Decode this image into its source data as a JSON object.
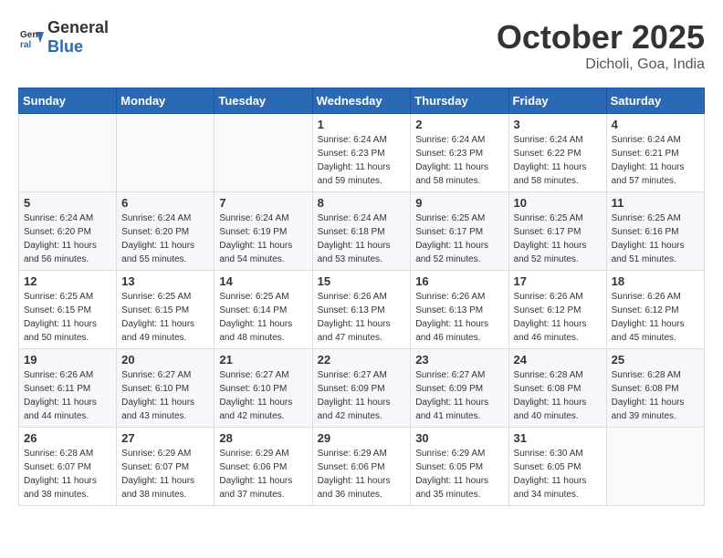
{
  "header": {
    "logo_general": "General",
    "logo_blue": "Blue",
    "month_title": "October 2025",
    "location": "Dicholi, Goa, India"
  },
  "weekdays": [
    "Sunday",
    "Monday",
    "Tuesday",
    "Wednesday",
    "Thursday",
    "Friday",
    "Saturday"
  ],
  "weeks": [
    [
      {
        "day": "",
        "info": ""
      },
      {
        "day": "",
        "info": ""
      },
      {
        "day": "",
        "info": ""
      },
      {
        "day": "1",
        "info": "Sunrise: 6:24 AM\nSunset: 6:23 PM\nDaylight: 11 hours\nand 59 minutes."
      },
      {
        "day": "2",
        "info": "Sunrise: 6:24 AM\nSunset: 6:23 PM\nDaylight: 11 hours\nand 58 minutes."
      },
      {
        "day": "3",
        "info": "Sunrise: 6:24 AM\nSunset: 6:22 PM\nDaylight: 11 hours\nand 58 minutes."
      },
      {
        "day": "4",
        "info": "Sunrise: 6:24 AM\nSunset: 6:21 PM\nDaylight: 11 hours\nand 57 minutes."
      }
    ],
    [
      {
        "day": "5",
        "info": "Sunrise: 6:24 AM\nSunset: 6:20 PM\nDaylight: 11 hours\nand 56 minutes."
      },
      {
        "day": "6",
        "info": "Sunrise: 6:24 AM\nSunset: 6:20 PM\nDaylight: 11 hours\nand 55 minutes."
      },
      {
        "day": "7",
        "info": "Sunrise: 6:24 AM\nSunset: 6:19 PM\nDaylight: 11 hours\nand 54 minutes."
      },
      {
        "day": "8",
        "info": "Sunrise: 6:24 AM\nSunset: 6:18 PM\nDaylight: 11 hours\nand 53 minutes."
      },
      {
        "day": "9",
        "info": "Sunrise: 6:25 AM\nSunset: 6:17 PM\nDaylight: 11 hours\nand 52 minutes."
      },
      {
        "day": "10",
        "info": "Sunrise: 6:25 AM\nSunset: 6:17 PM\nDaylight: 11 hours\nand 52 minutes."
      },
      {
        "day": "11",
        "info": "Sunrise: 6:25 AM\nSunset: 6:16 PM\nDaylight: 11 hours\nand 51 minutes."
      }
    ],
    [
      {
        "day": "12",
        "info": "Sunrise: 6:25 AM\nSunset: 6:15 PM\nDaylight: 11 hours\nand 50 minutes."
      },
      {
        "day": "13",
        "info": "Sunrise: 6:25 AM\nSunset: 6:15 PM\nDaylight: 11 hours\nand 49 minutes."
      },
      {
        "day": "14",
        "info": "Sunrise: 6:25 AM\nSunset: 6:14 PM\nDaylight: 11 hours\nand 48 minutes."
      },
      {
        "day": "15",
        "info": "Sunrise: 6:26 AM\nSunset: 6:13 PM\nDaylight: 11 hours\nand 47 minutes."
      },
      {
        "day": "16",
        "info": "Sunrise: 6:26 AM\nSunset: 6:13 PM\nDaylight: 11 hours\nand 46 minutes."
      },
      {
        "day": "17",
        "info": "Sunrise: 6:26 AM\nSunset: 6:12 PM\nDaylight: 11 hours\nand 46 minutes."
      },
      {
        "day": "18",
        "info": "Sunrise: 6:26 AM\nSunset: 6:12 PM\nDaylight: 11 hours\nand 45 minutes."
      }
    ],
    [
      {
        "day": "19",
        "info": "Sunrise: 6:26 AM\nSunset: 6:11 PM\nDaylight: 11 hours\nand 44 minutes."
      },
      {
        "day": "20",
        "info": "Sunrise: 6:27 AM\nSunset: 6:10 PM\nDaylight: 11 hours\nand 43 minutes."
      },
      {
        "day": "21",
        "info": "Sunrise: 6:27 AM\nSunset: 6:10 PM\nDaylight: 11 hours\nand 42 minutes."
      },
      {
        "day": "22",
        "info": "Sunrise: 6:27 AM\nSunset: 6:09 PM\nDaylight: 11 hours\nand 42 minutes."
      },
      {
        "day": "23",
        "info": "Sunrise: 6:27 AM\nSunset: 6:09 PM\nDaylight: 11 hours\nand 41 minutes."
      },
      {
        "day": "24",
        "info": "Sunrise: 6:28 AM\nSunset: 6:08 PM\nDaylight: 11 hours\nand 40 minutes."
      },
      {
        "day": "25",
        "info": "Sunrise: 6:28 AM\nSunset: 6:08 PM\nDaylight: 11 hours\nand 39 minutes."
      }
    ],
    [
      {
        "day": "26",
        "info": "Sunrise: 6:28 AM\nSunset: 6:07 PM\nDaylight: 11 hours\nand 38 minutes."
      },
      {
        "day": "27",
        "info": "Sunrise: 6:29 AM\nSunset: 6:07 PM\nDaylight: 11 hours\nand 38 minutes."
      },
      {
        "day": "28",
        "info": "Sunrise: 6:29 AM\nSunset: 6:06 PM\nDaylight: 11 hours\nand 37 minutes."
      },
      {
        "day": "29",
        "info": "Sunrise: 6:29 AM\nSunset: 6:06 PM\nDaylight: 11 hours\nand 36 minutes."
      },
      {
        "day": "30",
        "info": "Sunrise: 6:29 AM\nSunset: 6:05 PM\nDaylight: 11 hours\nand 35 minutes."
      },
      {
        "day": "31",
        "info": "Sunrise: 6:30 AM\nSunset: 6:05 PM\nDaylight: 11 hours\nand 34 minutes."
      },
      {
        "day": "",
        "info": ""
      }
    ]
  ]
}
